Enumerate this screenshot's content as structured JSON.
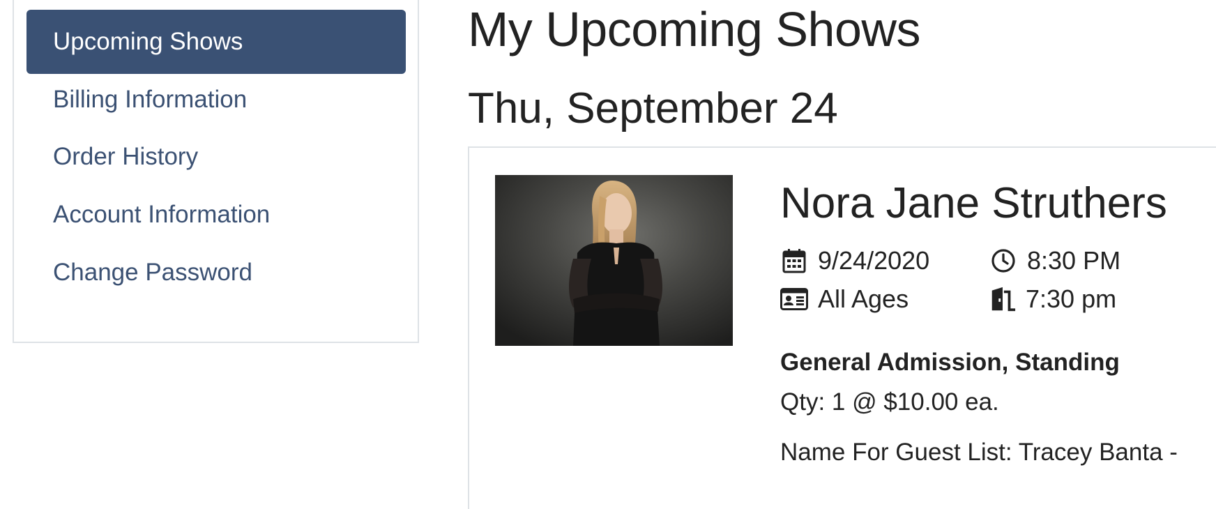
{
  "sidebar": {
    "items": [
      {
        "label": "Upcoming Shows",
        "active": true
      },
      {
        "label": "Billing Information",
        "active": false
      },
      {
        "label": "Order History",
        "active": false
      },
      {
        "label": "Account Information",
        "active": false
      },
      {
        "label": "Change Password",
        "active": false
      }
    ]
  },
  "main": {
    "title": "My Upcoming Shows",
    "date_heading": "Thu, September 24",
    "show": {
      "artist": "Nora Jane Struthers",
      "date": "9/24/2020",
      "show_time": "8:30 PM",
      "age_restriction": "All Ages",
      "doors_time": "7:30 pm",
      "ticket_type": "General Admission, Standing",
      "quantity_text": "Qty: 1 @ $10.00 ea.",
      "guest_list_text": "Name For Guest List: Tracey Banta -",
      "icons": {
        "date": "calendar-icon",
        "time": "clock-icon",
        "age": "id-card-icon",
        "doors": "door-open-icon"
      }
    }
  },
  "colors": {
    "active_nav_bg": "#3a5174",
    "nav_link": "#3b5173",
    "text": "#222222",
    "border": "#dee2e6"
  }
}
